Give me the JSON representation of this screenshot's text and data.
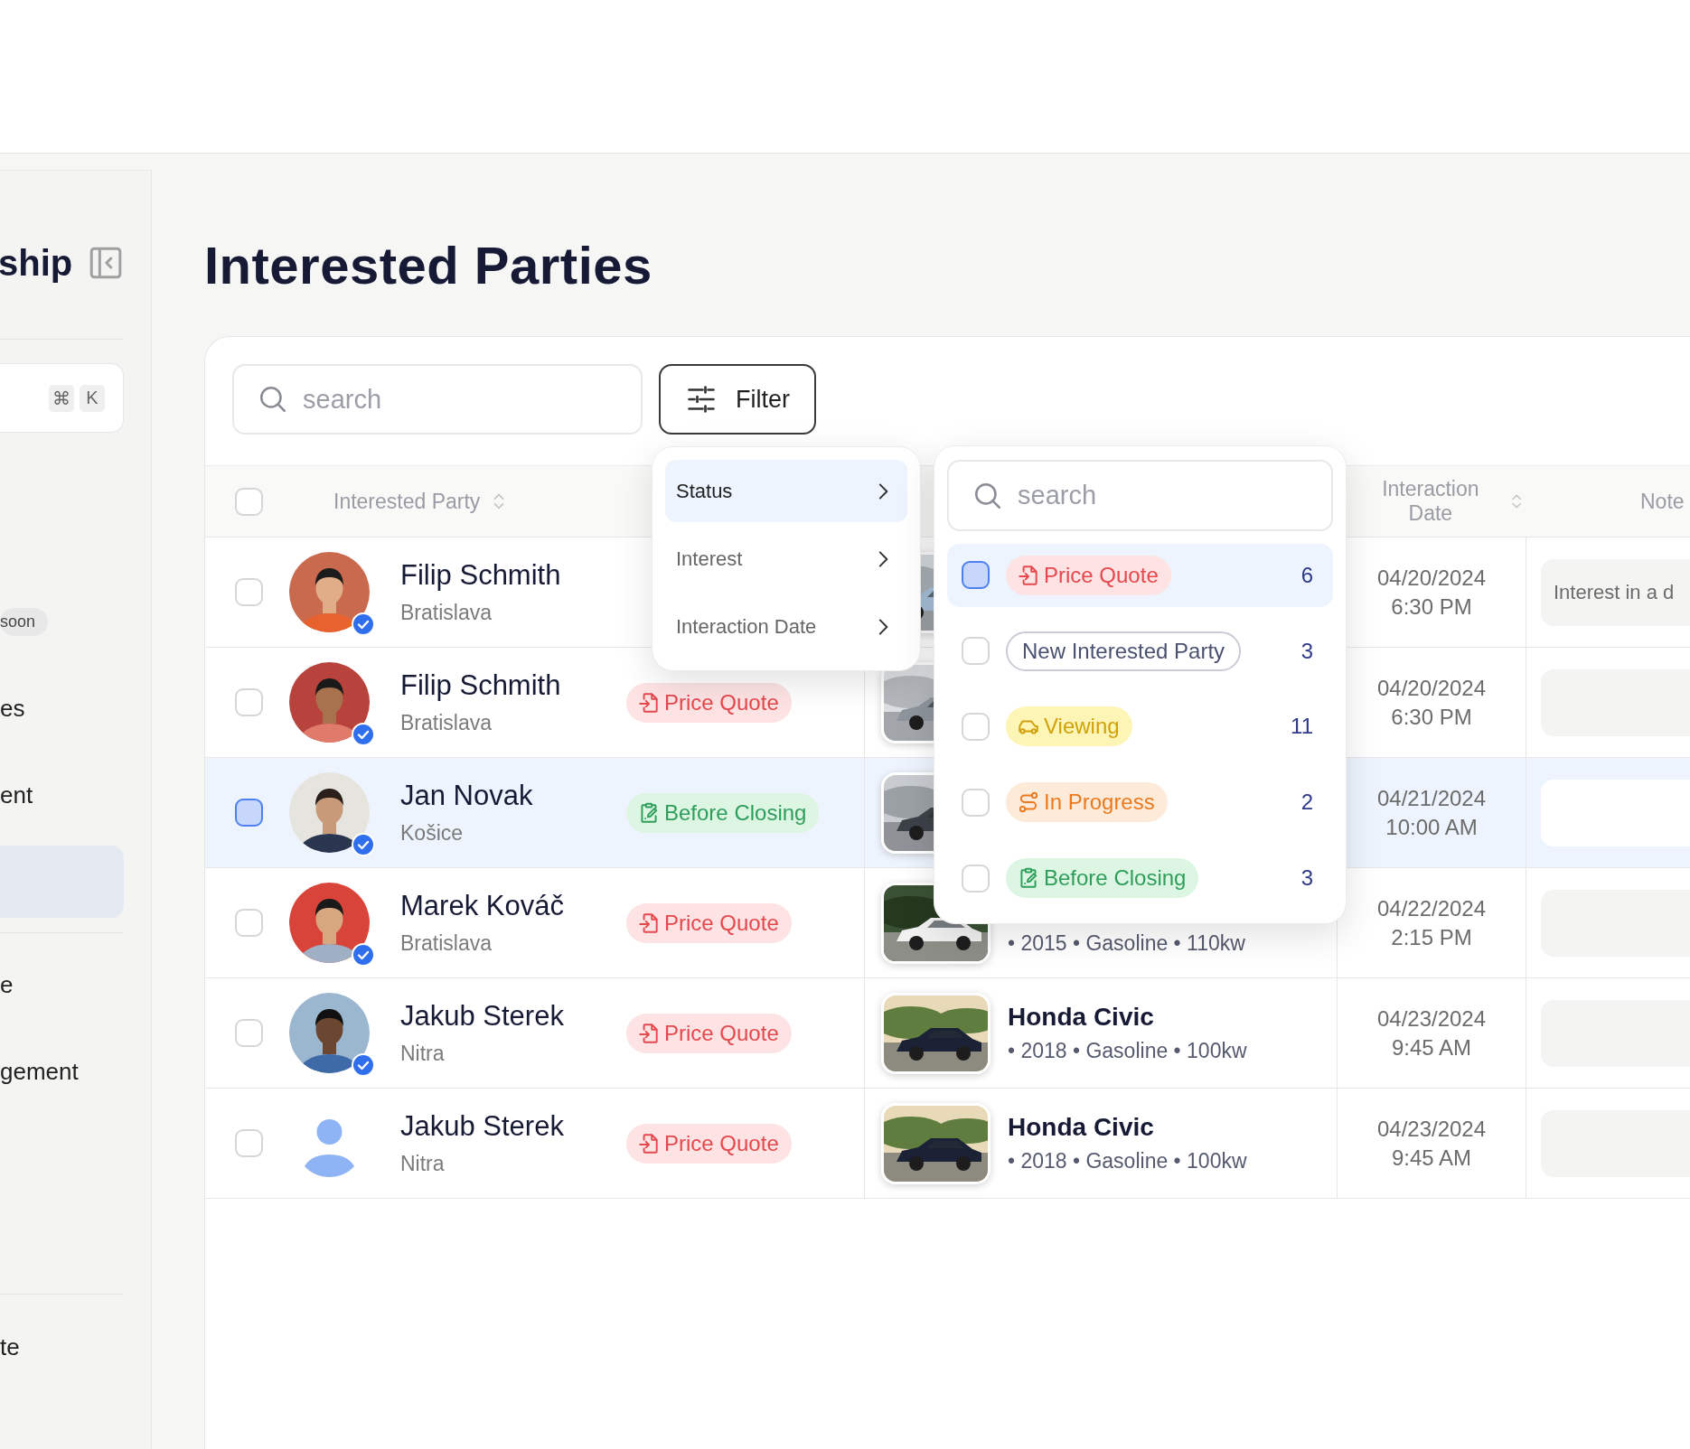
{
  "sidebar": {
    "title": "ship",
    "shortcut": [
      "⌘",
      "K"
    ],
    "items": [
      {
        "badge": "soon",
        "selected": false
      },
      {
        "label": "es",
        "selected": false
      },
      {
        "label": "ent",
        "selected": false
      },
      {
        "selected": true
      },
      {
        "label": "e",
        "selected": false
      },
      {
        "label": "gement",
        "selected": false
      }
    ],
    "footer": {
      "label": "te"
    }
  },
  "page": {
    "title": "Interested Parties"
  },
  "toolbar": {
    "search": {
      "placeholder": "search"
    },
    "filter_button": "Filter"
  },
  "table": {
    "header": {
      "all_checked": false,
      "party": {
        "label": "Interested Party",
        "sortable": true
      },
      "date": {
        "label": "Interaction Date",
        "sortable": true
      },
      "note": {
        "label": "Note"
      }
    },
    "rows": [
      {
        "selected": false,
        "avatar": {
          "kind": "picture",
          "verified": true
        },
        "name": "Filip Schmith",
        "city": "Bratislava",
        "date": "04/20/2024",
        "time": "6:30 PM",
        "note": "Interest in a d"
      },
      {
        "selected": false,
        "avatar": {
          "kind": "picture",
          "verified": true
        },
        "name": "Filip Schmith",
        "city": "Bratislava",
        "status": {
          "kind": "price_quote",
          "label": "Price Quote"
        },
        "date": "04/20/2024",
        "time": "6:30 PM"
      },
      {
        "selected": true,
        "avatar": {
          "kind": "picture",
          "verified": true
        },
        "name": "Jan Novak",
        "city": "Košice",
        "status": {
          "kind": "before_closing",
          "label": "Before Closing"
        },
        "date": "04/21/2024",
        "time": "10:00 AM"
      },
      {
        "selected": false,
        "avatar": {
          "kind": "picture",
          "verified": true
        },
        "name": "Marek Kováč",
        "city": "Bratislava",
        "status": {
          "kind": "price_quote",
          "label": "Price Quote"
        },
        "vehicle": {
          "specs": "• 2015 • Gasoline • 110kw"
        },
        "date": "04/22/2024",
        "time": "2:15 PM"
      },
      {
        "selected": false,
        "avatar": {
          "kind": "picture",
          "verified": true
        },
        "name": "Jakub Sterek",
        "city": "Nitra",
        "status": {
          "kind": "price_quote",
          "label": "Price Quote"
        },
        "vehicle": {
          "model": "Honda Civic",
          "specs": "• 2018 • Gasoline • 100kw"
        },
        "date": "04/23/2024",
        "time": "9:45 AM"
      },
      {
        "selected": false,
        "avatar": {
          "kind": "placeholder",
          "verified": false
        },
        "name": "Jakub Sterek",
        "city": "Nitra",
        "status": {
          "kind": "price_quote",
          "label": "Price Quote"
        },
        "vehicle": {
          "model": "Honda Civic",
          "specs": "• 2018 • Gasoline • 100kw"
        },
        "date": "04/23/2024",
        "time": "9:45 AM"
      }
    ]
  },
  "filter_menu": {
    "items": [
      {
        "label": "Status",
        "selected": true
      },
      {
        "label": "Interest",
        "selected": false
      },
      {
        "label": "Interaction Date",
        "selected": false
      }
    ]
  },
  "status_menu": {
    "search": {
      "placeholder": "search"
    },
    "options": [
      {
        "kind": "price_quote",
        "label": "Price Quote",
        "count": "6",
        "selected": true
      },
      {
        "kind": "new",
        "label": "New Interested Party",
        "count": "3",
        "selected": false
      },
      {
        "kind": "viewing",
        "label": "Viewing",
        "count": "11",
        "selected": false
      },
      {
        "kind": "in_progress",
        "label": "In Progress",
        "count": "2",
        "selected": false
      },
      {
        "kind": "before_closing",
        "label": "Before Closing",
        "count": "3",
        "selected": false
      }
    ]
  }
}
